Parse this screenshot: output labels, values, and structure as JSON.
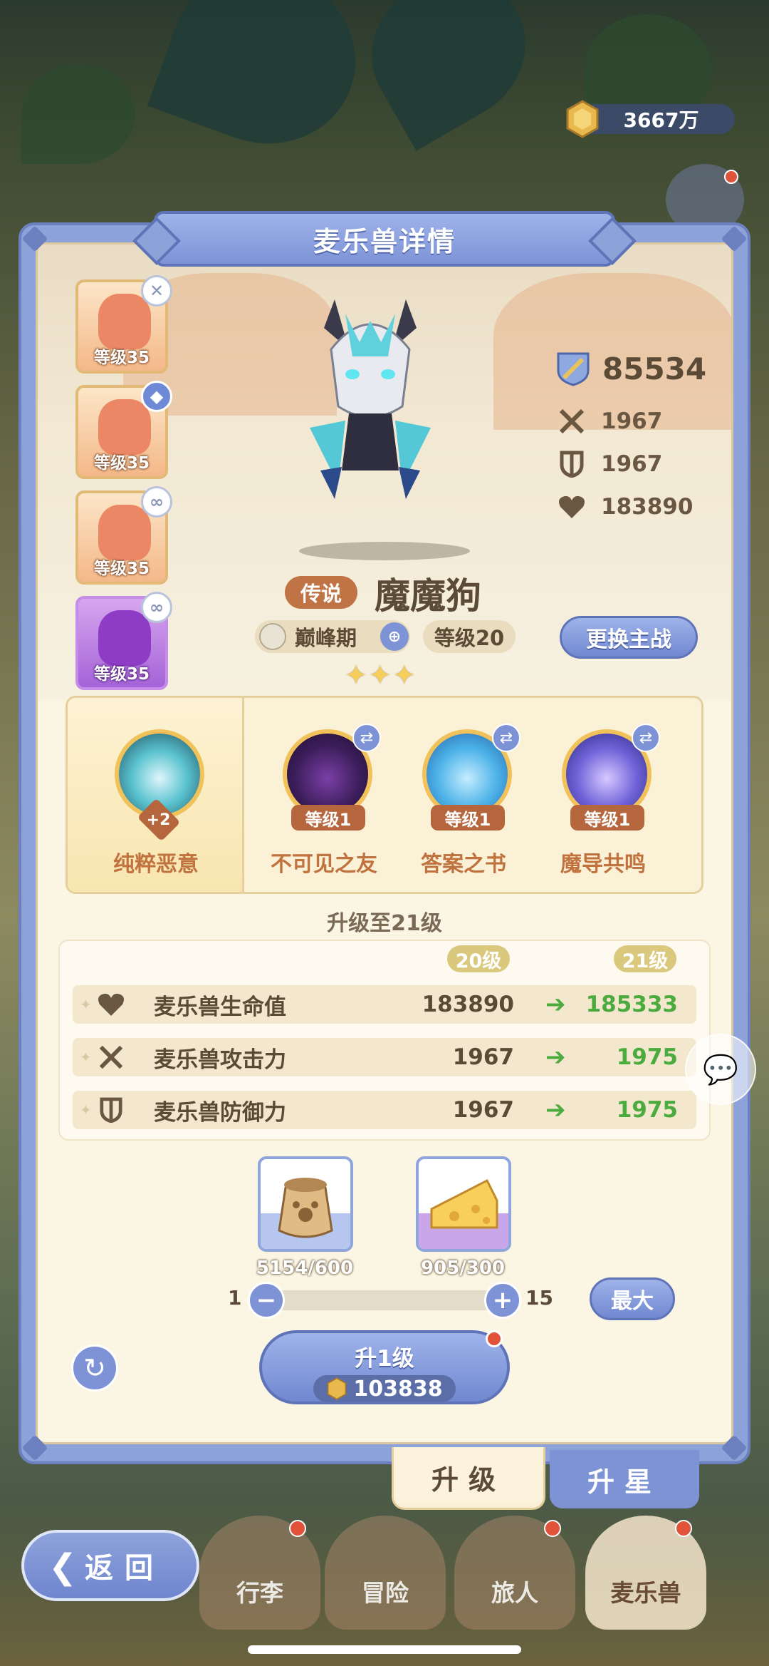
{
  "header": {
    "coins": "3667万"
  },
  "panel": {
    "title": "麦乐兽详情"
  },
  "team": [
    {
      "level": "等级35",
      "badge": "✕",
      "badge_icon": "close-icon"
    },
    {
      "level": "等级35",
      "badge": "◆",
      "badge_icon": "shield-icon"
    },
    {
      "level": "等级35",
      "badge": "∞",
      "badge_icon": "link-icon"
    },
    {
      "level": "等级35",
      "badge": "∞",
      "badge_icon": "link-icon"
    }
  ],
  "pet": {
    "power": "85534",
    "attack": "1967",
    "defense": "1967",
    "hp": "183890",
    "rarity": "传说",
    "name": "魔魔狗",
    "stage": "巅峰期",
    "level": "等级20",
    "swap_label": "更换主战",
    "stars": 3
  },
  "skills": {
    "main": {
      "label": "纯粹恶意",
      "plus": "+2"
    },
    "others": [
      {
        "label": "不可见之友",
        "level": "等级1"
      },
      {
        "label": "答案之书",
        "level": "等级1"
      },
      {
        "label": "魔导共鸣",
        "level": "等级1"
      }
    ]
  },
  "upgrade": {
    "heading": "升级至21级",
    "col_from": "20级",
    "col_to": "21级",
    "rows": [
      {
        "name": "麦乐兽生命值",
        "from": "183890",
        "to": "185333"
      },
      {
        "name": "麦乐兽攻击力",
        "from": "1967",
        "to": "1975"
      },
      {
        "name": "麦乐兽防御力",
        "from": "1967",
        "to": "1975"
      }
    ],
    "materials": [
      {
        "count": "5154/600"
      },
      {
        "count": "905/300"
      }
    ],
    "slider_min": "1",
    "slider_max": "15",
    "max_label": "最大",
    "button_label": "升1级",
    "cost": "103838"
  },
  "tabs": {
    "level": "升级",
    "star": "升星"
  },
  "nav": {
    "back": "返回",
    "items": [
      "行李",
      "冒险",
      "旅人",
      "麦乐兽"
    ]
  }
}
